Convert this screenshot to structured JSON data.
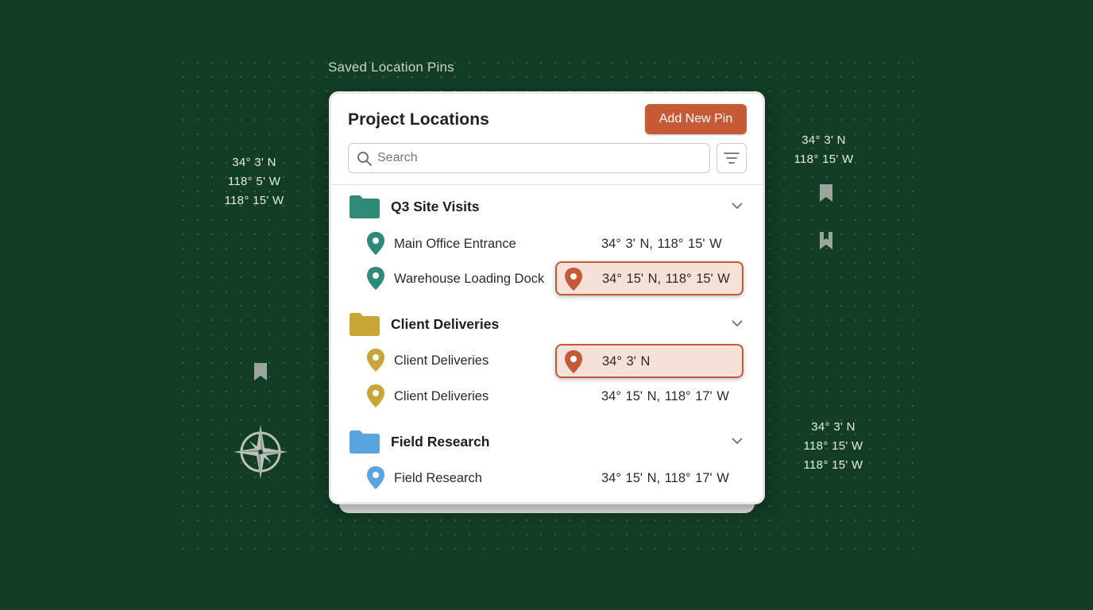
{
  "caption": "Saved Location Pins",
  "left_coords": [
    "34° 3' N",
    "118° 5' W",
    "118° 15' W"
  ],
  "right_top_coords": [
    "34° 3' N",
    "118° 15' W"
  ],
  "right_bottom_coords": [
    "34° 3' N",
    "118° 15' W",
    "118° 15' W"
  ],
  "panel": {
    "title": "Project Locations",
    "add_button": "Add New Pin",
    "search_placeholder": "Search"
  },
  "groups": [
    {
      "name": "Q3 Site Visits",
      "color": "#2e8b78",
      "items": [
        {
          "name": "Main Office Entrance",
          "coord": "34° 3' N,  118° 15' W"
        },
        {
          "name": "Warehouse Loading Dock",
          "coord": "34° 15' N,  118° 15' W",
          "highlighted": true
        }
      ]
    },
    {
      "name": "Client Deliveries",
      "color": "#c9a538",
      "items": [
        {
          "name": "Client Deliveries",
          "coord": "34° 3' N",
          "highlighted": true
        },
        {
          "name": "Client Deliveries",
          "coord": "34° 15' N,  118° 17' W"
        }
      ]
    },
    {
      "name": "Field Research",
      "color": "#5aa4e0",
      "items": [
        {
          "name": "Field Research",
          "coord": "34° 15' N,  118° 17' W"
        }
      ]
    }
  ],
  "colors": {
    "background": "#133d25",
    "accent": "#c65a36",
    "highlight_fill": "#f6e1d8"
  },
  "icons": [
    "search-icon",
    "filter-icon",
    "folder-icon",
    "chevron-down-icon",
    "map-pin-icon",
    "bookmark-icon",
    "compass-rose-icon"
  ]
}
